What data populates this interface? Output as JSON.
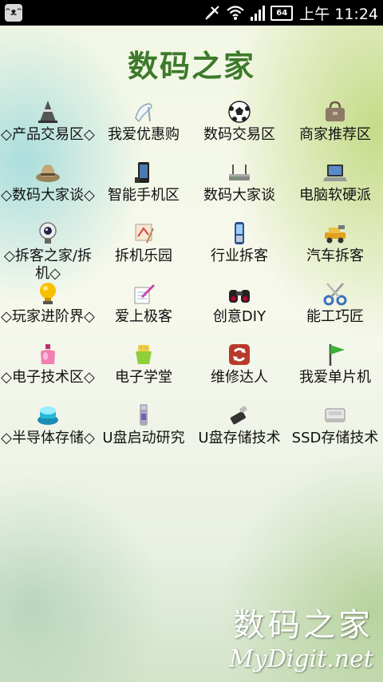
{
  "status_bar": {
    "battery": "64",
    "time": "上午 11:24",
    "app_icon": "cat-app-icon",
    "icons": [
      "mute-icon",
      "wifi-icon",
      "signal-icon",
      "battery-icon"
    ]
  },
  "header": {
    "title": "数码之家"
  },
  "grid": {
    "items": [
      {
        "label": "◇产品交易区◇",
        "icon": "traffic-cone-icon"
      },
      {
        "label": "我爱优惠购",
        "icon": "high-heel-icon"
      },
      {
        "label": "数码交易区",
        "icon": "soccer-ball-icon"
      },
      {
        "label": "商家推荐区",
        "icon": "handbag-icon"
      },
      {
        "label": "◇数码大家谈◇",
        "icon": "hat-icon"
      },
      {
        "label": "智能手机区",
        "icon": "smartphone-icon"
      },
      {
        "label": "数码大家谈",
        "icon": "router-icon"
      },
      {
        "label": "电脑软硬派",
        "icon": "laptop-icon"
      },
      {
        "label": "◇拆客之家/拆机◇",
        "icon": "webcam-icon"
      },
      {
        "label": "拆机乐园",
        "icon": "drawing-board-icon"
      },
      {
        "label": "行业拆客",
        "icon": "mobile-phone-icon"
      },
      {
        "label": "汽车拆客",
        "icon": "toy-car-icon"
      },
      {
        "label": "◇玩家进阶界◇",
        "icon": "trophy-bulb-icon"
      },
      {
        "label": "爱上极客",
        "icon": "notepad-pen-icon"
      },
      {
        "label": "创意DIY",
        "icon": "binoculars-icon"
      },
      {
        "label": "能工巧匠",
        "icon": "scissors-icon"
      },
      {
        "label": "◇电子技术区◇",
        "icon": "perfume-bottle-icon"
      },
      {
        "label": "电子学堂",
        "icon": "sponge-bucket-icon"
      },
      {
        "label": "维修达人",
        "icon": "refresh-tool-icon"
      },
      {
        "label": "我爱单片机",
        "icon": "green-flag-icon"
      },
      {
        "label": "◇半导体存储◇",
        "icon": "chip-stack-icon"
      },
      {
        "label": "U盘启动研究",
        "icon": "usb-drive-icon"
      },
      {
        "label": "U盘存储技术",
        "icon": "usb-stick-icon"
      },
      {
        "label": "SSD存储技术",
        "icon": "ssd-drive-icon"
      }
    ]
  },
  "watermark": {
    "line1": "数码之家",
    "line2": "MyDigit.net"
  }
}
